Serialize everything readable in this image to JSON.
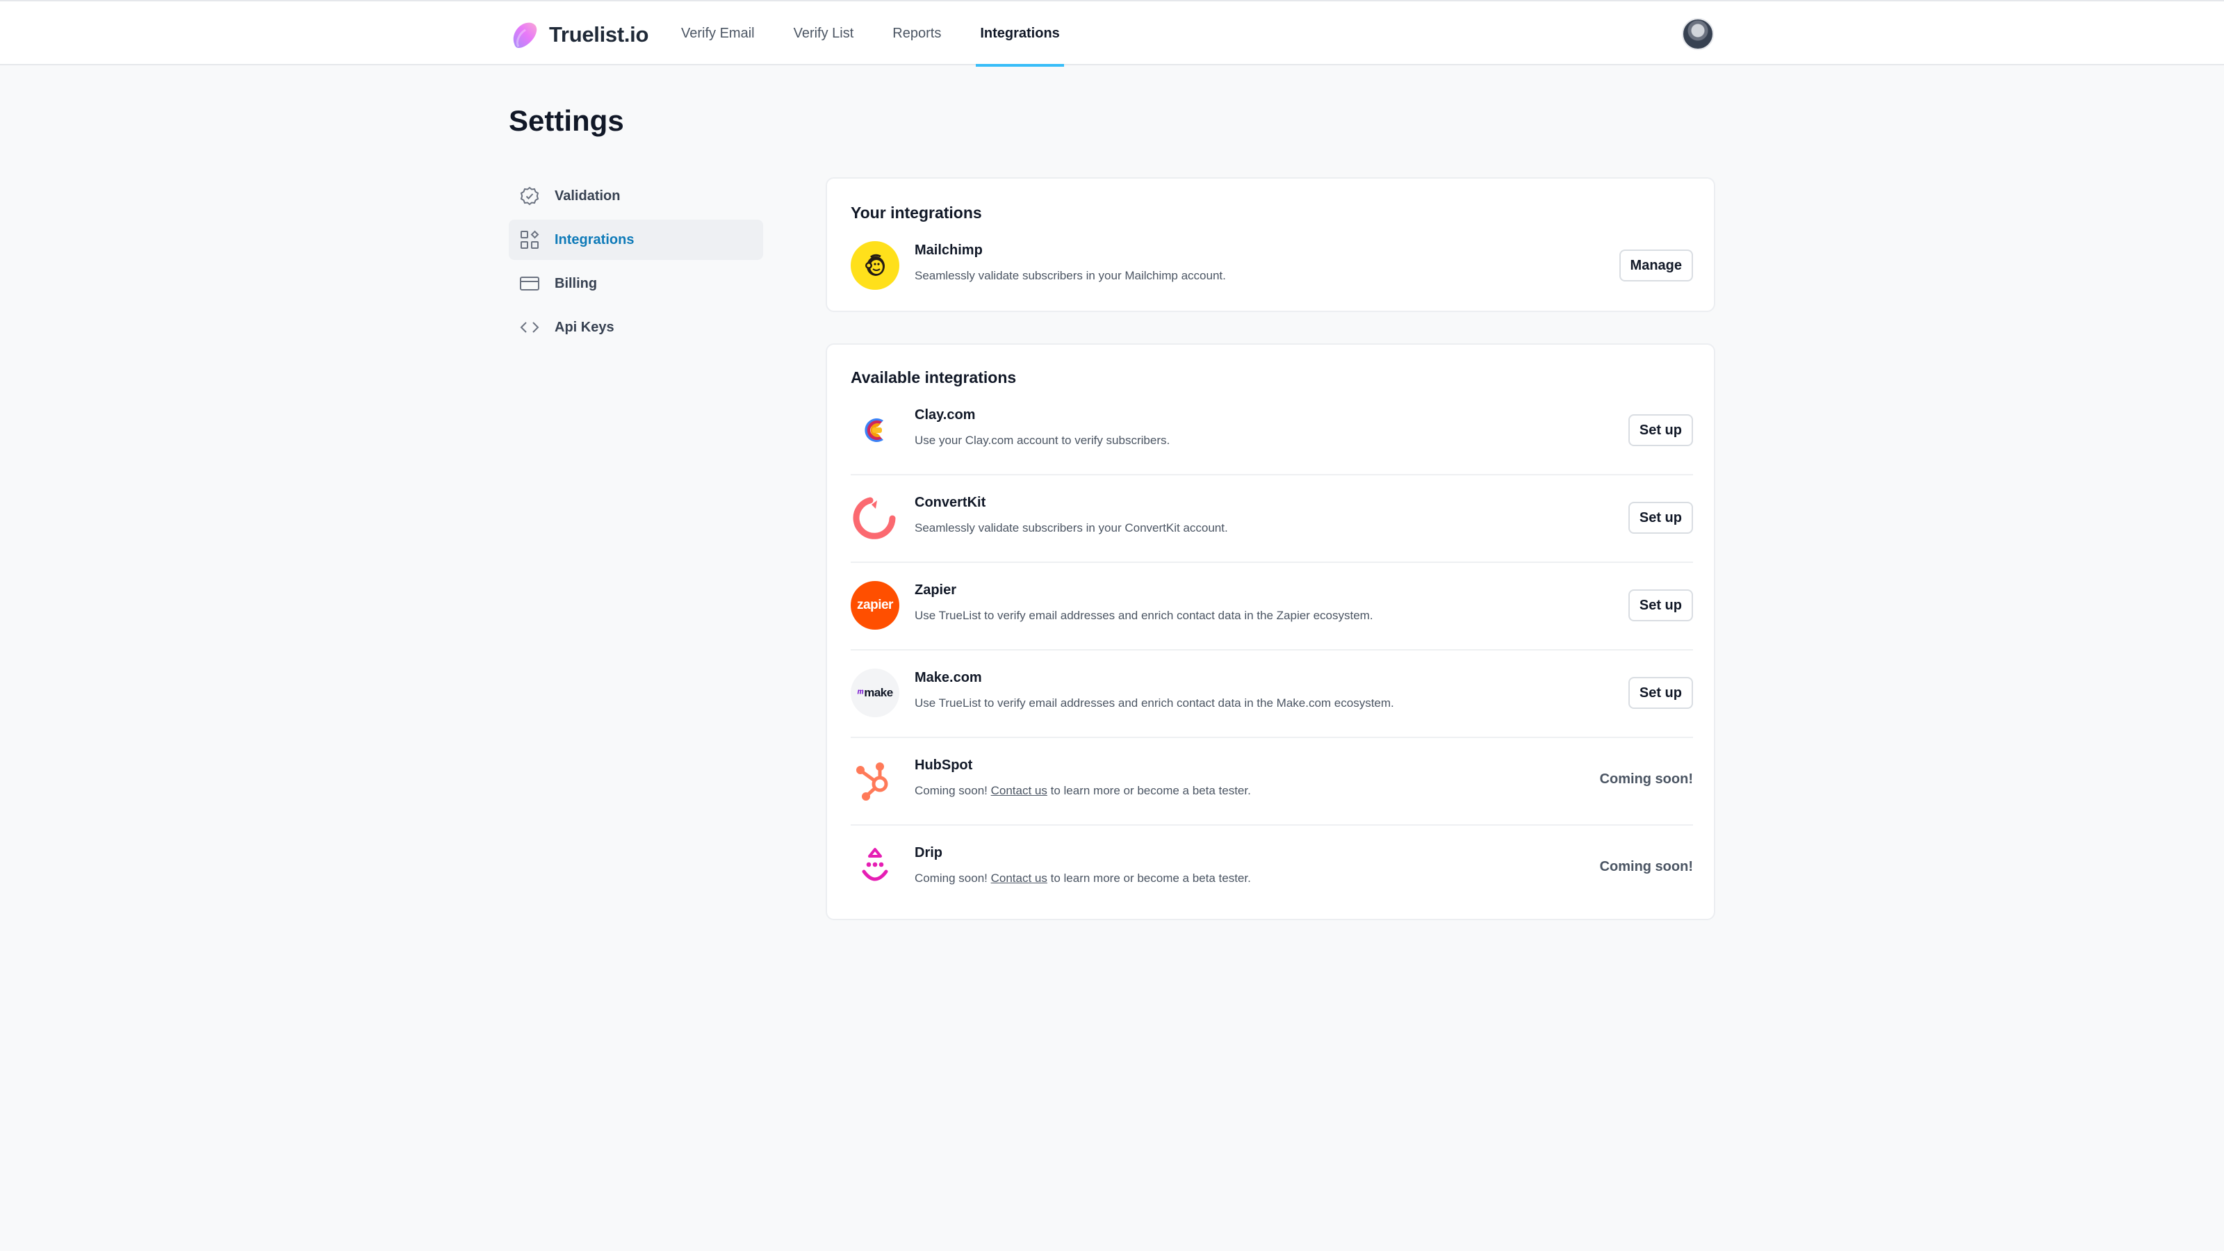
{
  "brand": {
    "name": "Truelist.io"
  },
  "nav": {
    "tabs": [
      {
        "label": "Verify Email"
      },
      {
        "label": "Verify List"
      },
      {
        "label": "Reports"
      },
      {
        "label": "Integrations",
        "active": true
      }
    ]
  },
  "page": {
    "title": "Settings"
  },
  "sidebar": {
    "items": [
      {
        "label": "Validation",
        "icon": "badge-check-icon"
      },
      {
        "label": "Integrations",
        "icon": "grid-shapes-icon",
        "active": true
      },
      {
        "label": "Billing",
        "icon": "credit-card-icon"
      },
      {
        "label": "Api Keys",
        "icon": "code-brackets-icon"
      }
    ]
  },
  "your_integrations": {
    "title": "Your integrations",
    "items": [
      {
        "name": "Mailchimp",
        "description": "Seamlessly validate subscribers in your Mailchimp account.",
        "action": "Manage",
        "icon": "mailchimp-logo",
        "color": "#ffe01b"
      }
    ]
  },
  "available_integrations": {
    "title": "Available integrations",
    "items": [
      {
        "name": "Clay.com",
        "description": "Use your Clay.com account to verify subscribers.",
        "action": "Set up",
        "icon": "clay-logo"
      },
      {
        "name": "ConvertKit",
        "description": "Seamlessly validate subscribers in your ConvertKit account.",
        "action": "Set up",
        "icon": "convertkit-logo",
        "color": "#fb6970"
      },
      {
        "name": "Zapier",
        "description": "Use TrueList to verify email addresses and enrich contact data in the Zapier ecosystem.",
        "action": "Set up",
        "icon": "zapier-logo",
        "logo_text": "zapier",
        "color": "#ff4f00"
      },
      {
        "name": "Make.com",
        "description": "Use TrueList to verify email addresses and enrich contact data in the Make.com ecosystem.",
        "action": "Set up",
        "icon": "make-logo",
        "logo_text": "make"
      },
      {
        "name": "HubSpot",
        "desc_prefix": "Coming soon! ",
        "desc_link": "Contact us",
        "desc_suffix": " to learn more or become a beta tester.",
        "status": "Coming soon!",
        "icon": "hubspot-logo",
        "color": "#ff7a59"
      },
      {
        "name": "Drip",
        "desc_prefix": "Coming soon! ",
        "desc_link": "Contact us",
        "desc_suffix": " to learn more or become a beta tester.",
        "status": "Coming soon!",
        "icon": "drip-logo",
        "color": "#e61eb4"
      }
    ]
  }
}
